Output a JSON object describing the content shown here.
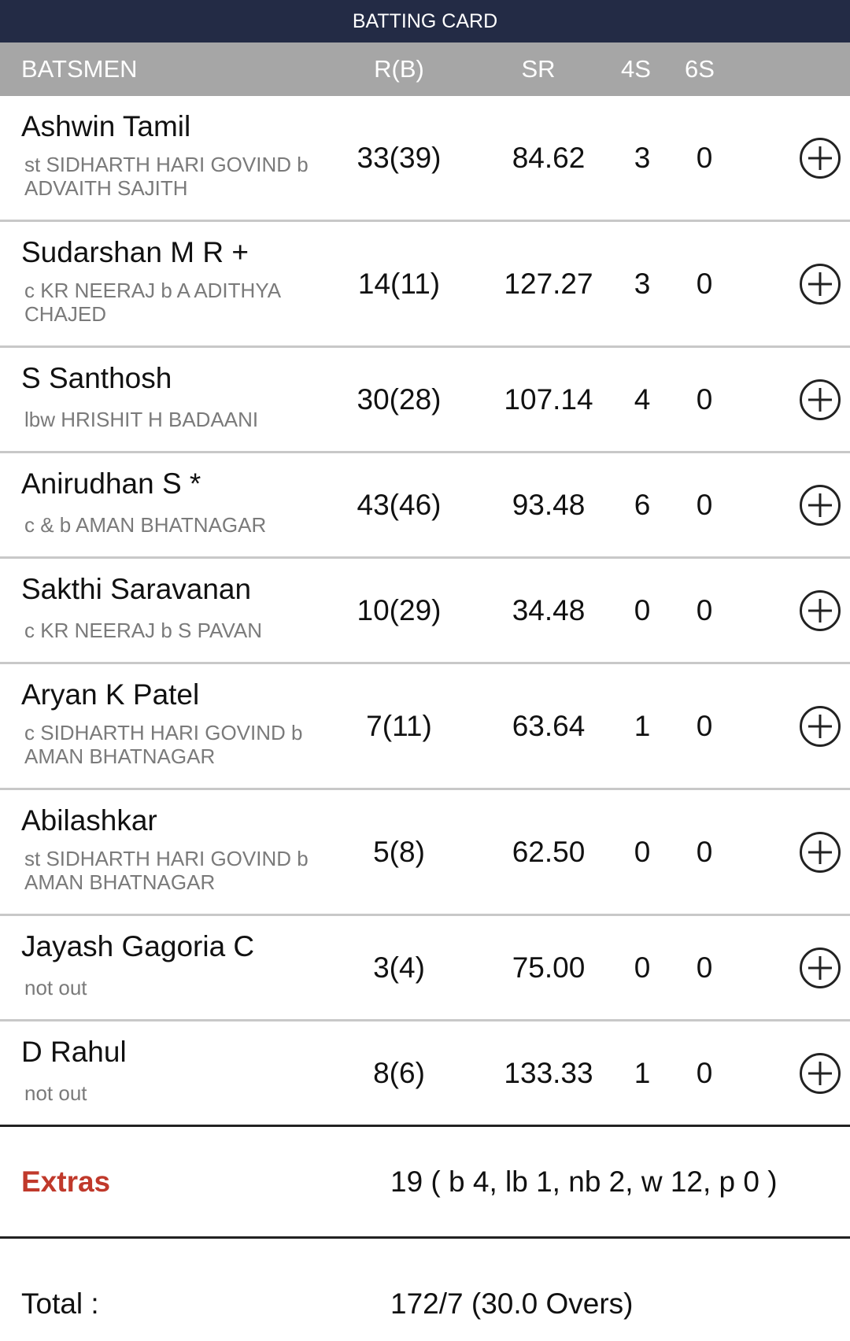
{
  "title": "BATTING CARD",
  "columns": {
    "batsmen": "BATSMEN",
    "rb": "R(B)",
    "sr": "SR",
    "fours": "4S",
    "sixes": "6S"
  },
  "batsmen": [
    {
      "name": "Ashwin Tamil",
      "dismissal": "st SIDHARTH HARI GOVIND b ADVAITH SAJITH",
      "rb": "33(39)",
      "sr": "84.62",
      "fours": "3",
      "sixes": "0"
    },
    {
      "name": "Sudarshan M R +",
      "dismissal": "c KR NEERAJ b A ADITHYA CHAJED",
      "rb": "14(11)",
      "sr": "127.27",
      "fours": "3",
      "sixes": "0"
    },
    {
      "name": "S Santhosh",
      "dismissal": "lbw HRISHIT H BADAANI",
      "rb": "30(28)",
      "sr": "107.14",
      "fours": "4",
      "sixes": "0"
    },
    {
      "name": "Anirudhan S *",
      "dismissal": "c & b AMAN BHATNAGAR",
      "rb": "43(46)",
      "sr": "93.48",
      "fours": "6",
      "sixes": "0"
    },
    {
      "name": "Sakthi Saravanan",
      "dismissal": "c KR NEERAJ b S PAVAN",
      "rb": "10(29)",
      "sr": "34.48",
      "fours": "0",
      "sixes": "0"
    },
    {
      "name": "Aryan K Patel",
      "dismissal": "c SIDHARTH HARI GOVIND b AMAN BHATNAGAR",
      "rb": "7(11)",
      "sr": "63.64",
      "fours": "1",
      "sixes": "0"
    },
    {
      "name": "Abilashkar",
      "dismissal": "st SIDHARTH HARI GOVIND b AMAN BHATNAGAR",
      "rb": "5(8)",
      "sr": "62.50",
      "fours": "0",
      "sixes": "0"
    },
    {
      "name": "Jayash Gagoria C",
      "dismissal": "not out",
      "rb": "3(4)",
      "sr": "75.00",
      "fours": "0",
      "sixes": "0"
    },
    {
      "name": "D Rahul",
      "dismissal": "not out",
      "rb": "8(6)",
      "sr": "133.33",
      "fours": "1",
      "sixes": "0"
    }
  ],
  "extras": {
    "label": "Extras",
    "value": "19 ( b 4, lb 1, nb 2, w 12, p 0 )"
  },
  "total": {
    "label": "Total :",
    "value": "172/7 (30.0 Overs)"
  },
  "colors": {
    "topbar": "#232b45",
    "header": "#a6a6a6",
    "extras_label": "#c0392b"
  }
}
